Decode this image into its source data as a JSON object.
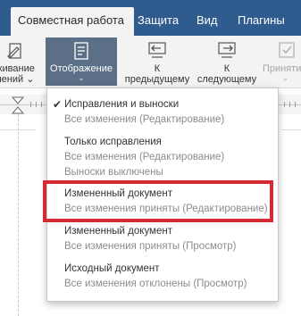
{
  "tabs": [
    {
      "label": "Совместная работа",
      "active": true
    },
    {
      "label": "Защита"
    },
    {
      "label": "Вид"
    },
    {
      "label": "Плагины"
    }
  ],
  "toolbar": {
    "tracking_label_1": "живание",
    "tracking_label_2": "нений ⌄",
    "display_label": "Отображение",
    "display_caret": "⌄",
    "previous_label_1": "К",
    "previous_label_2": "предыдущему",
    "next_label_1": "К",
    "next_label_2": "следующему",
    "accept_label": "Приняти",
    "accept_caret": "⌄"
  },
  "menu": {
    "items": [
      {
        "title": "Исправления и выноски",
        "subtitles": [
          "Все изменения (Редактирование)"
        ],
        "checked": true
      },
      {
        "title": "Только исправления",
        "subtitles": [
          "Все изменения (Редактирование)",
          "Выноски выключены"
        ]
      },
      {
        "title": "Измененный документ",
        "subtitles": [
          "Все изменения приняты (Редактирование)"
        ],
        "highlighted": true
      },
      {
        "title": "Измененный документ",
        "subtitles": [
          "Все изменения приняты (Просмотр)"
        ]
      },
      {
        "title": "Исходный документ",
        "subtitles": [
          "Все изменения отклонены (Просмотр)"
        ]
      }
    ],
    "check_mark": "✔"
  },
  "colors": {
    "tab_bar": "#2f5b8f",
    "active_button": "#5b6f86",
    "highlight_border": "#d42a32"
  }
}
